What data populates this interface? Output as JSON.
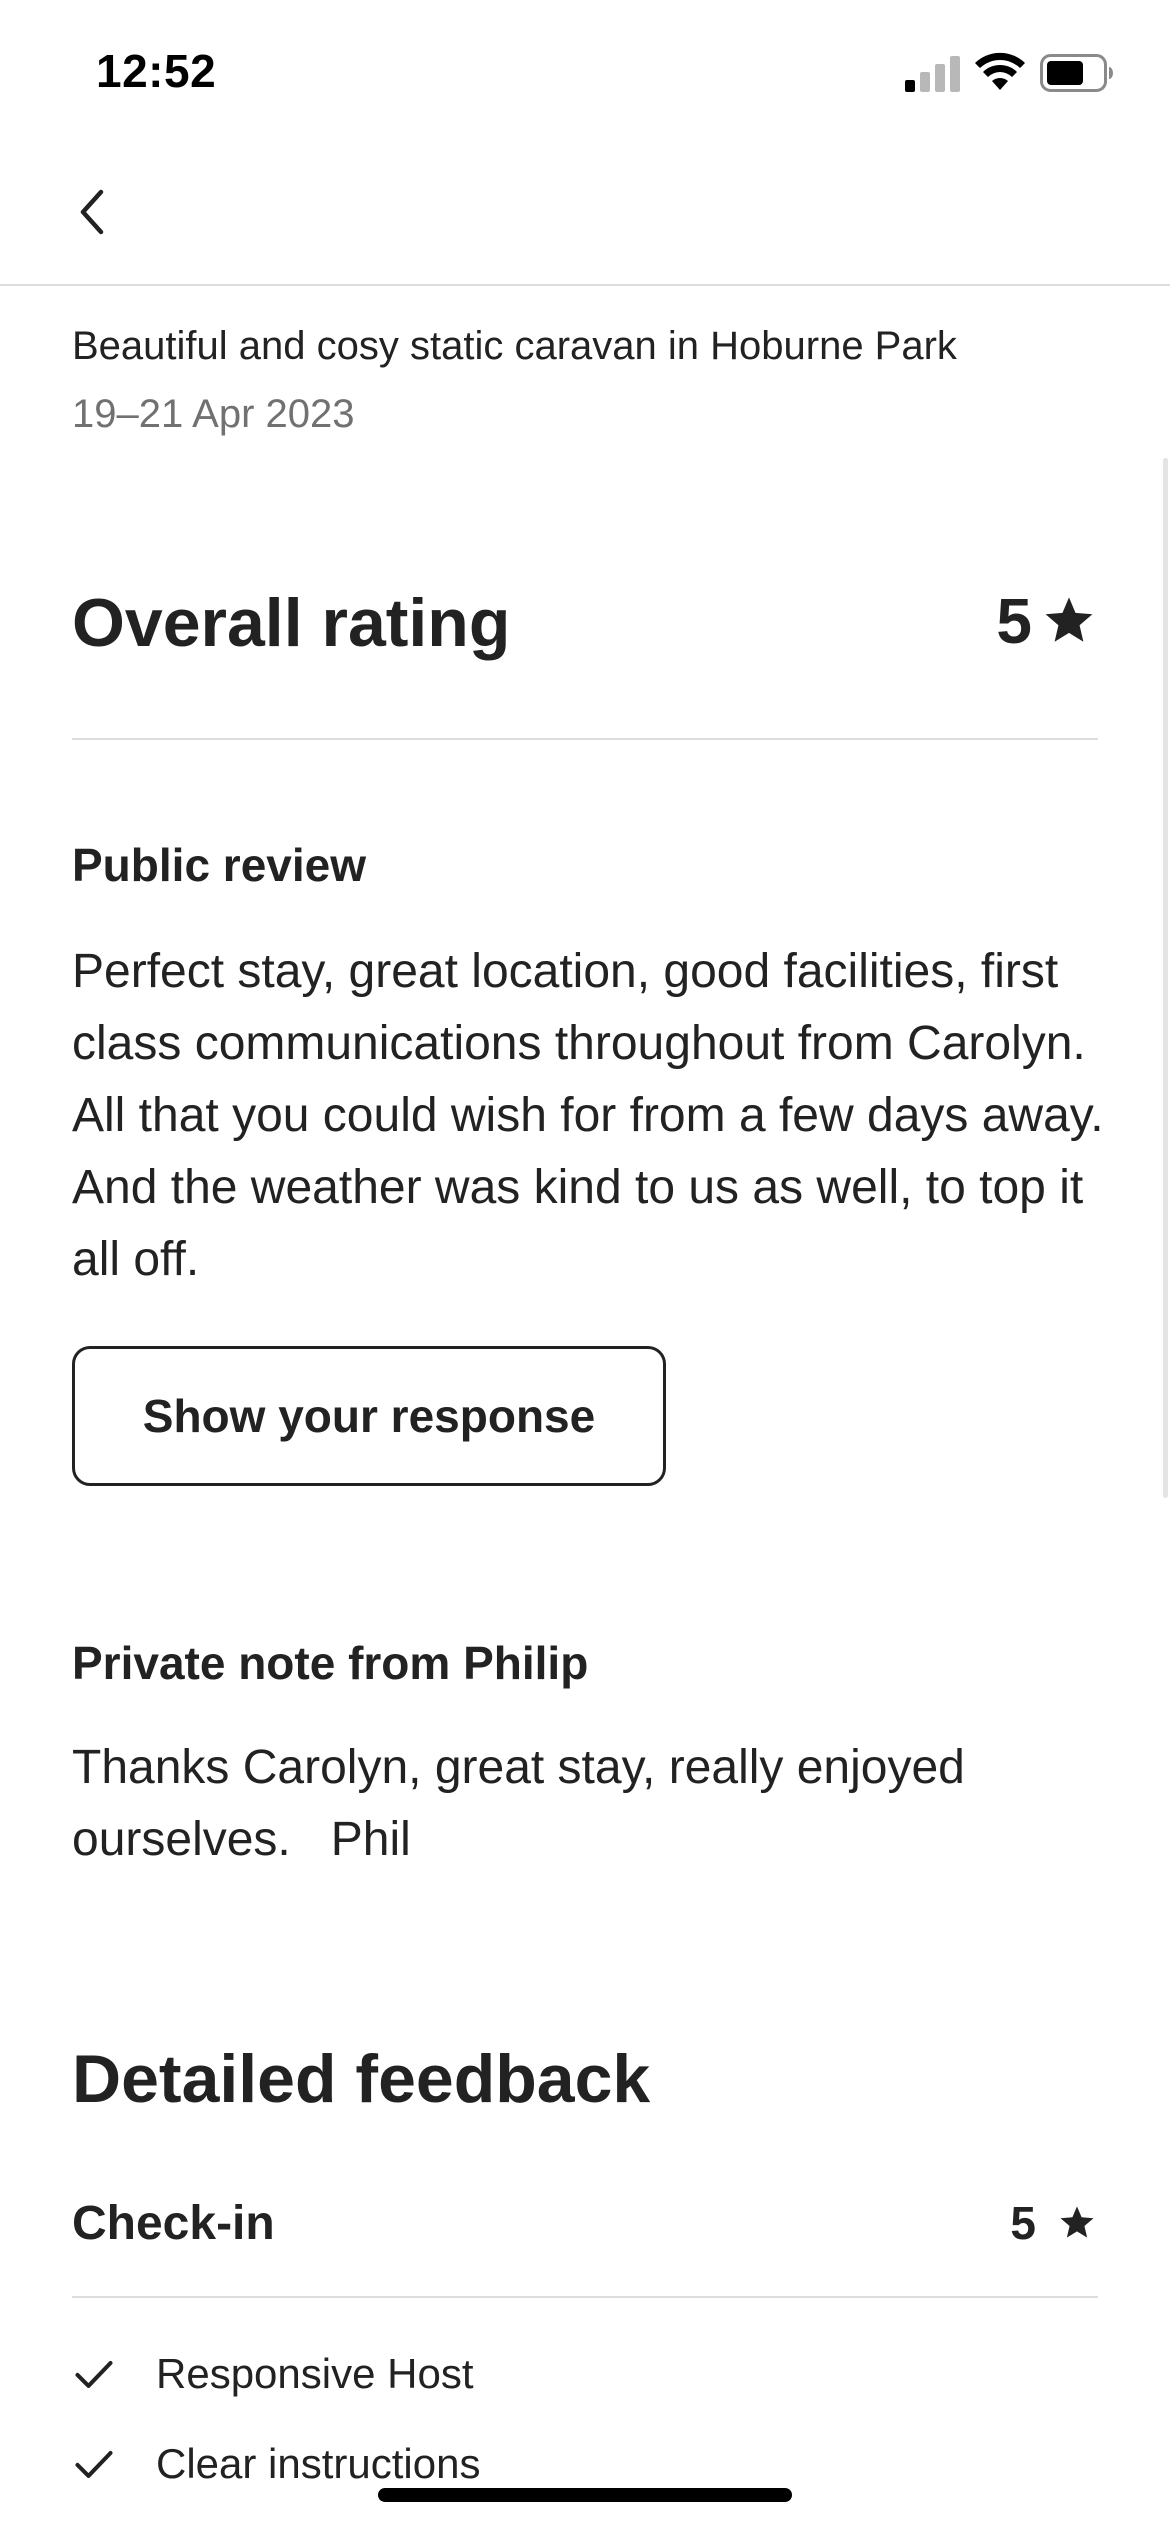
{
  "status_bar": {
    "time": "12:52"
  },
  "header": {
    "back_icon": "chevron-left-icon"
  },
  "listing": {
    "title": "Beautiful and cosy static caravan in Hoburne Park",
    "dates": "19–21 Apr 2023"
  },
  "overall_rating": {
    "label": "Overall rating",
    "value": "5",
    "icon": "star-icon"
  },
  "public_review": {
    "heading": "Public review",
    "text": "Perfect stay, great location, good facilities, first class communications throughout from Carolyn.   All that you could wish for from a few days away.   And the weather was kind to us as well, to top it all off.",
    "button_label": "Show your response"
  },
  "private_note": {
    "heading": "Private note from Philip",
    "text": "Thanks Carolyn, great stay, really enjoyed ourselves.   Phil"
  },
  "detailed_feedback": {
    "heading": "Detailed feedback",
    "categories": [
      {
        "label": "Check-in",
        "value": "5",
        "items": [
          "Responsive Host",
          "Clear instructions"
        ]
      }
    ]
  },
  "colors": {
    "text": "#222222",
    "secondary_text": "#717171",
    "divider": "#dddddd"
  }
}
